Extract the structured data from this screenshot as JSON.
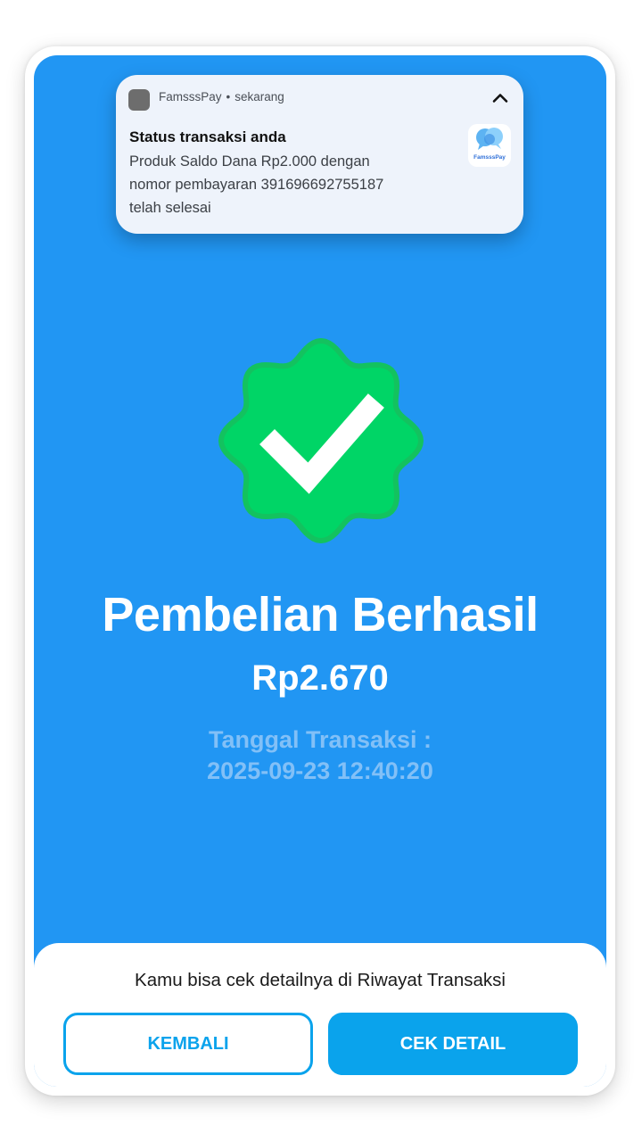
{
  "notification": {
    "app_name": "FamsssPay",
    "separator": "•",
    "time": "sekarang",
    "title": "Status transaksi anda",
    "body_lines": [
      "Produk Saldo Dana Rp2.000 dengan",
      "nomor pembayaran 391696692755187",
      "telah selesai"
    ],
    "logo_text": "FamsssPay",
    "icons": {
      "app": "app-icon",
      "collapse": "chevron-up-icon",
      "logo": "famssspay-logo-icon"
    }
  },
  "result": {
    "icon": "verified-check-badge-icon",
    "title": "Pembelian Berhasil",
    "amount": "Rp2.670",
    "date_label": "Tanggal Transaksi :",
    "date_value": "2025-09-23 12:40:20"
  },
  "bottom_sheet": {
    "hint": "Kamu bisa cek detailnya di Riwayat Transaksi",
    "back_label": "KEMBALI",
    "detail_label": "CEK DETAIL"
  },
  "colors": {
    "background": "#2196f3",
    "badge": "#00d566",
    "accent": "#0aa3ec",
    "date_text": "#82c0f7"
  }
}
